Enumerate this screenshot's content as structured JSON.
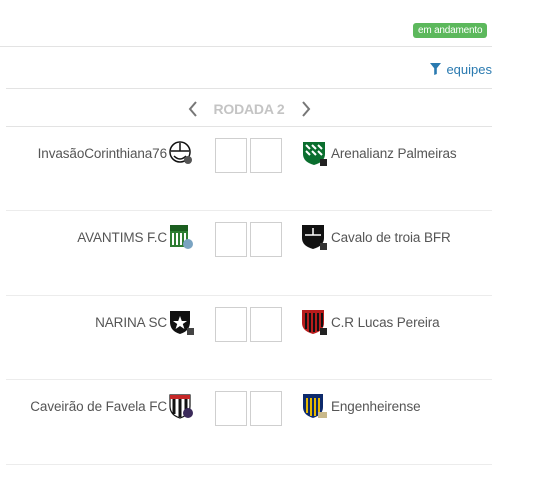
{
  "status": {
    "label": "em andamento",
    "color": "#5cb85c"
  },
  "filter": {
    "label": "equipes",
    "icon": "filter-icon",
    "color": "#2a7ab0"
  },
  "round": {
    "label": "RODADA 2",
    "prev_icon": "chevron-left-icon",
    "next_icon": "chevron-right-icon"
  },
  "matches": [
    {
      "home": "InvasãoCorinthiana76",
      "away": "Arenalianz Palmeiras",
      "home_score": "",
      "away_score": ""
    },
    {
      "home": "AVANTIMS F.C",
      "away": "Cavalo de troia BFR",
      "home_score": "",
      "away_score": ""
    },
    {
      "home": "NARINA SC",
      "away": "C.R Lucas Pereira",
      "home_score": "",
      "away_score": ""
    },
    {
      "home": "Caveirão de Favela FC",
      "away": "Engenheirense",
      "home_score": "",
      "away_score": ""
    }
  ]
}
